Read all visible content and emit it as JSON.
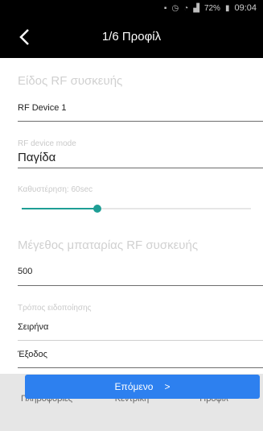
{
  "status_bar": {
    "battery": "72%",
    "time": "09:04"
  },
  "app_bar": {
    "title": "1/6 Προφίλ"
  },
  "form": {
    "device_type_label": "Είδος RF συσκευής",
    "device_type_value": "RF Device 1",
    "device_mode_label": "RF device mode",
    "device_mode_value": "Παγίδα",
    "delay_label": "Καθυστέρηση: 60sec",
    "delay_fraction": 0.33,
    "battery_size_label": "Μέγεθος μπαταρίας RF συσκευής",
    "battery_size_value": "500",
    "notify_label": "Τρόπος ειδοποίησης",
    "notify_option_1": "Σειρήνα",
    "notify_option_2": "Έξοδος"
  },
  "next_button": {
    "label": "Επόμενο",
    "arrow": ">"
  },
  "bottom_nav": {
    "items": [
      {
        "label": "Πληροφορίες",
        "icon": "info-icon"
      },
      {
        "label": "Κεντρική",
        "icon": "home-icon"
      },
      {
        "label": "Προφίλ",
        "icon": "people-icon"
      }
    ]
  },
  "colors": {
    "accent": "#1e9e95",
    "button": "#2d80ef",
    "bar": "#000000",
    "nav_bg": "#e6e6e6"
  }
}
